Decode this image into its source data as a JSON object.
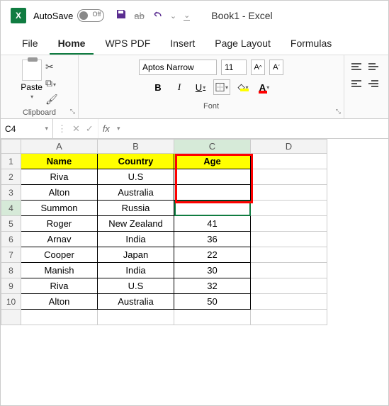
{
  "app": {
    "autosave_label": "AutoSave",
    "autosave_state": "Off",
    "title": "Book1  -  Excel"
  },
  "tabs": {
    "file": "File",
    "home": "Home",
    "wps": "WPS PDF",
    "insert": "Insert",
    "layout": "Page Layout",
    "formulas": "Formulas"
  },
  "ribbon": {
    "paste": "Paste",
    "clipboard": "Clipboard",
    "font_name": "Aptos Narrow",
    "font_size": "11",
    "font_group": "Font",
    "bold": "B",
    "italic": "I",
    "underline": "U",
    "bucket": "A",
    "fontcolor": "A"
  },
  "namebox": "C4",
  "fx": "fx",
  "columns": [
    "A",
    "B",
    "C",
    "D"
  ],
  "headers": {
    "name": "Name",
    "country": "Country",
    "age": "Age"
  },
  "rows": [
    {
      "n": "1"
    },
    {
      "n": "2",
      "name": "Riva",
      "country": "U.S",
      "age": ""
    },
    {
      "n": "3",
      "name": "Alton",
      "country": "Australia",
      "age": ""
    },
    {
      "n": "4",
      "name": "Summon",
      "country": "Russia",
      "age": ""
    },
    {
      "n": "5",
      "name": "Roger",
      "country": "New Zealand",
      "age": "41"
    },
    {
      "n": "6",
      "name": "Arnav",
      "country": "India",
      "age": "36"
    },
    {
      "n": "7",
      "name": "Cooper",
      "country": "Japan",
      "age": "22"
    },
    {
      "n": "8",
      "name": "Manish",
      "country": "India",
      "age": "30"
    },
    {
      "n": "9",
      "name": "Riva",
      "country": "U.S",
      "age": "32"
    },
    {
      "n": "10",
      "name": "Alton",
      "country": "Australia",
      "age": "50"
    }
  ],
  "selection": {
    "cell": "C4",
    "red_box_rows": [
      2,
      3,
      4
    ],
    "red_box_col": "C"
  }
}
